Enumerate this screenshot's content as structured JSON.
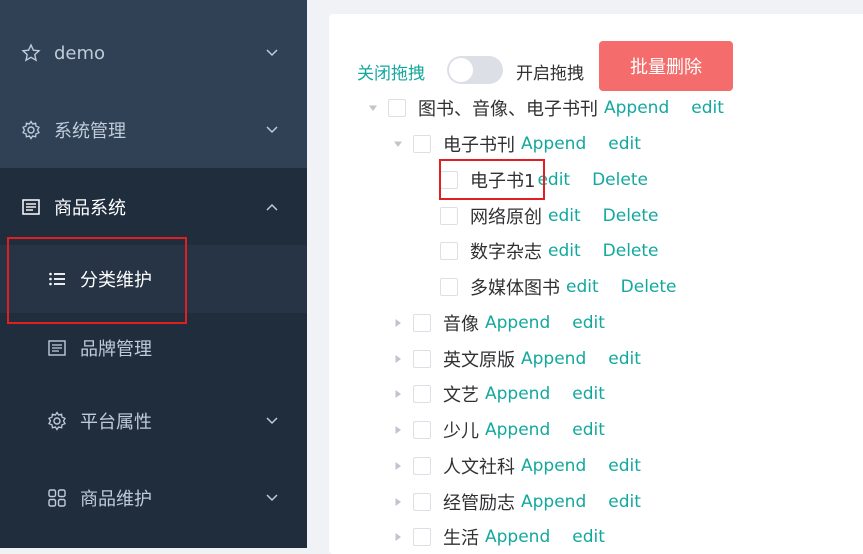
{
  "sidebar": {
    "items": [
      {
        "label": "demo",
        "icon": "star-icon"
      },
      {
        "label": "系统管理",
        "icon": "gear-icon"
      },
      {
        "label": "商品系统",
        "icon": "document-icon"
      },
      {
        "label": "分类维护",
        "icon": "list-icon"
      },
      {
        "label": "品牌管理",
        "icon": "document-icon"
      },
      {
        "label": "平台属性",
        "icon": "gear-icon"
      },
      {
        "label": "商品维护",
        "icon": "grid-icon"
      }
    ]
  },
  "toolbar": {
    "drag_off_label": "关闭拖拽",
    "drag_on_label": "开启拖拽",
    "batch_delete_label": "批量删除"
  },
  "tree": {
    "append_label": "Append",
    "edit_label": "edit",
    "delete_label": "Delete",
    "root": {
      "label": "图书、音像、电子书刊"
    },
    "nodes": [
      {
        "label": "电子书刊"
      },
      {
        "label": "电子书1"
      },
      {
        "label": "网络原创"
      },
      {
        "label": "数字杂志"
      },
      {
        "label": "多媒体图书"
      },
      {
        "label": "音像"
      },
      {
        "label": "英文原版"
      },
      {
        "label": "文艺"
      },
      {
        "label": "少儿"
      },
      {
        "label": "人文社科"
      },
      {
        "label": "经管励志"
      },
      {
        "label": "生活"
      }
    ]
  },
  "colors": {
    "sidebar_bg": "#304156",
    "submenu_bg": "#1f2d3d",
    "accent": "#13a89e",
    "danger": "#f56c6c",
    "highlight_box": "#e02020"
  }
}
